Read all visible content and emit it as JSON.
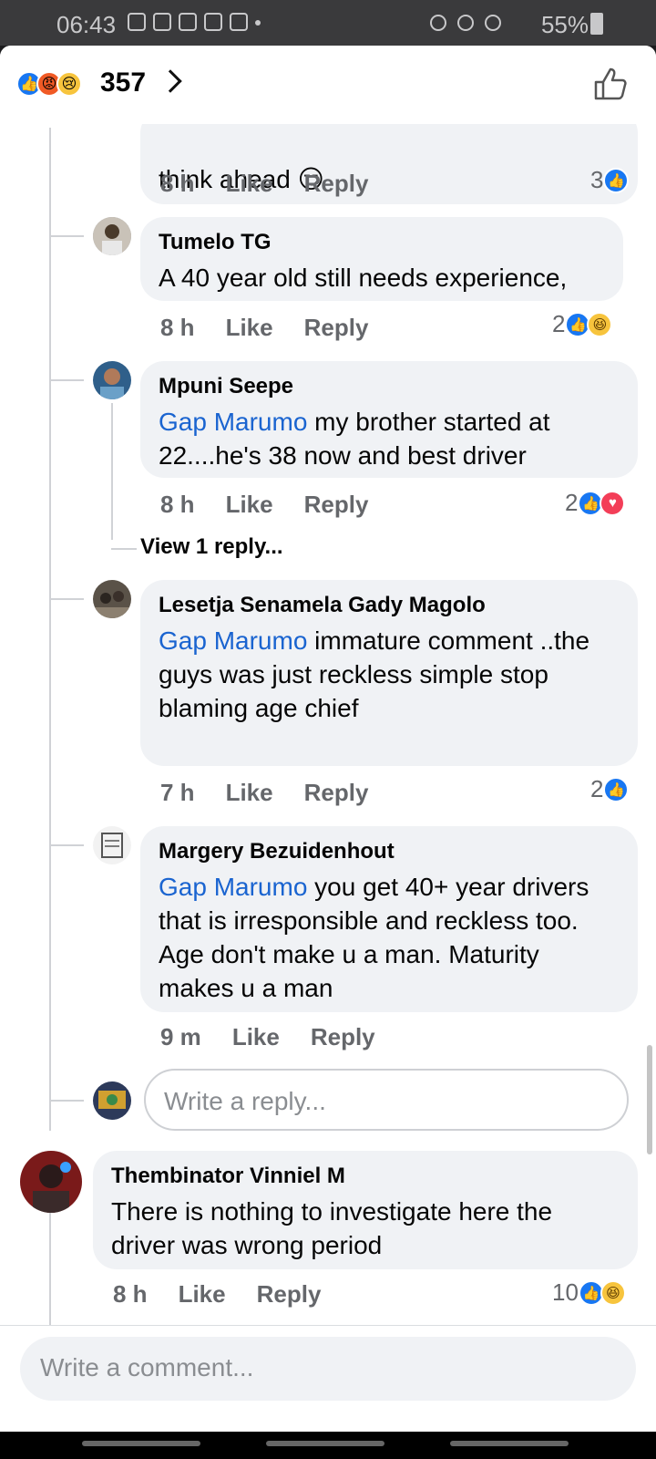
{
  "status": {
    "time": "06:43",
    "battery": "55%"
  },
  "header": {
    "reaction_count": "357"
  },
  "comments": [
    {
      "partial_text": "think ahead 😏",
      "time": "8 h",
      "like": "Like",
      "reply": "Reply",
      "reactions": "3"
    },
    {
      "name": "Tumelo TG",
      "text": "A 40 year old still needs experience,",
      "time": "8 h",
      "like": "Like",
      "reply": "Reply",
      "reactions": "2"
    },
    {
      "name": "Mpuni Seepe",
      "tag": "Gap Marumo",
      "text": " my brother started at 22....he's 38 now and best driver",
      "time": "8 h",
      "like": "Like",
      "reply": "Reply",
      "reactions": "2"
    },
    {
      "name": "Lesetja Senamela Gady Magolo",
      "tag": "Gap Marumo",
      "text": " immature comment ..the guys was just reckless simple stop blaming age chief",
      "time": "7 h",
      "like": "Like",
      "reply": "Reply",
      "reactions": "2"
    },
    {
      "name": "Margery Bezuidenhout",
      "tag": "Gap Marumo",
      "text": " you get 40+ year drivers that is irresponsible and reckless too. Age don't make u a man. Maturity makes u a man",
      "time": "9 m",
      "like": "Like",
      "reply": "Reply"
    },
    {
      "name": "Thembinator Vinniel M",
      "text": "There is nothing to investigate here the driver was wrong period",
      "time": "8 h",
      "like": "Like",
      "reply": "Reply",
      "reactions": "10"
    }
  ],
  "view_reply": "View 1 reply...",
  "reply_placeholder": "Write a reply...",
  "comment_placeholder": "Write a comment..."
}
